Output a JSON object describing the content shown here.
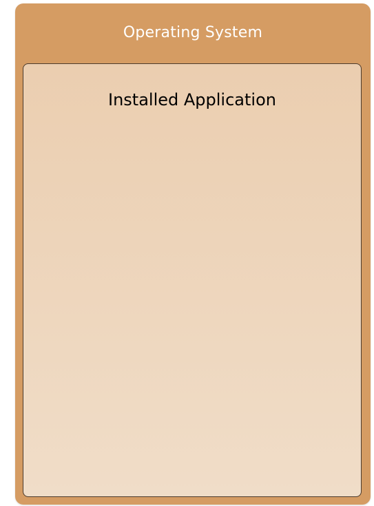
{
  "layers": {
    "outer": {
      "label": "Operating System",
      "color": "#d59c63"
    },
    "inner": {
      "label": "Installed Application",
      "color": "#ebceb0"
    }
  }
}
